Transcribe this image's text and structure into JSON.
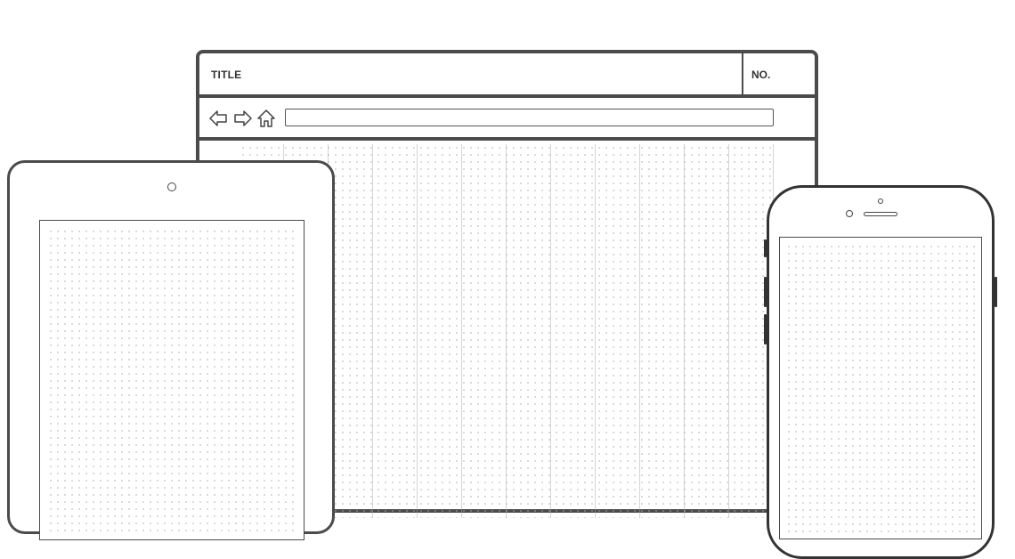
{
  "browser": {
    "title": "TITLE",
    "number_label": "NO.",
    "nav": {
      "back_icon": "arrow-left-icon",
      "forward_icon": "arrow-right-icon",
      "home_icon": "home-icon"
    },
    "address_bar_value": ""
  },
  "tablet": {
    "camera_icon": "camera-icon"
  },
  "phone": {
    "camera_icon": "camera-icon",
    "speaker": "speaker-slot"
  },
  "colors": {
    "frame": "#4b4b4b",
    "dots": "#a9a9a9",
    "background": "#ffffff"
  }
}
